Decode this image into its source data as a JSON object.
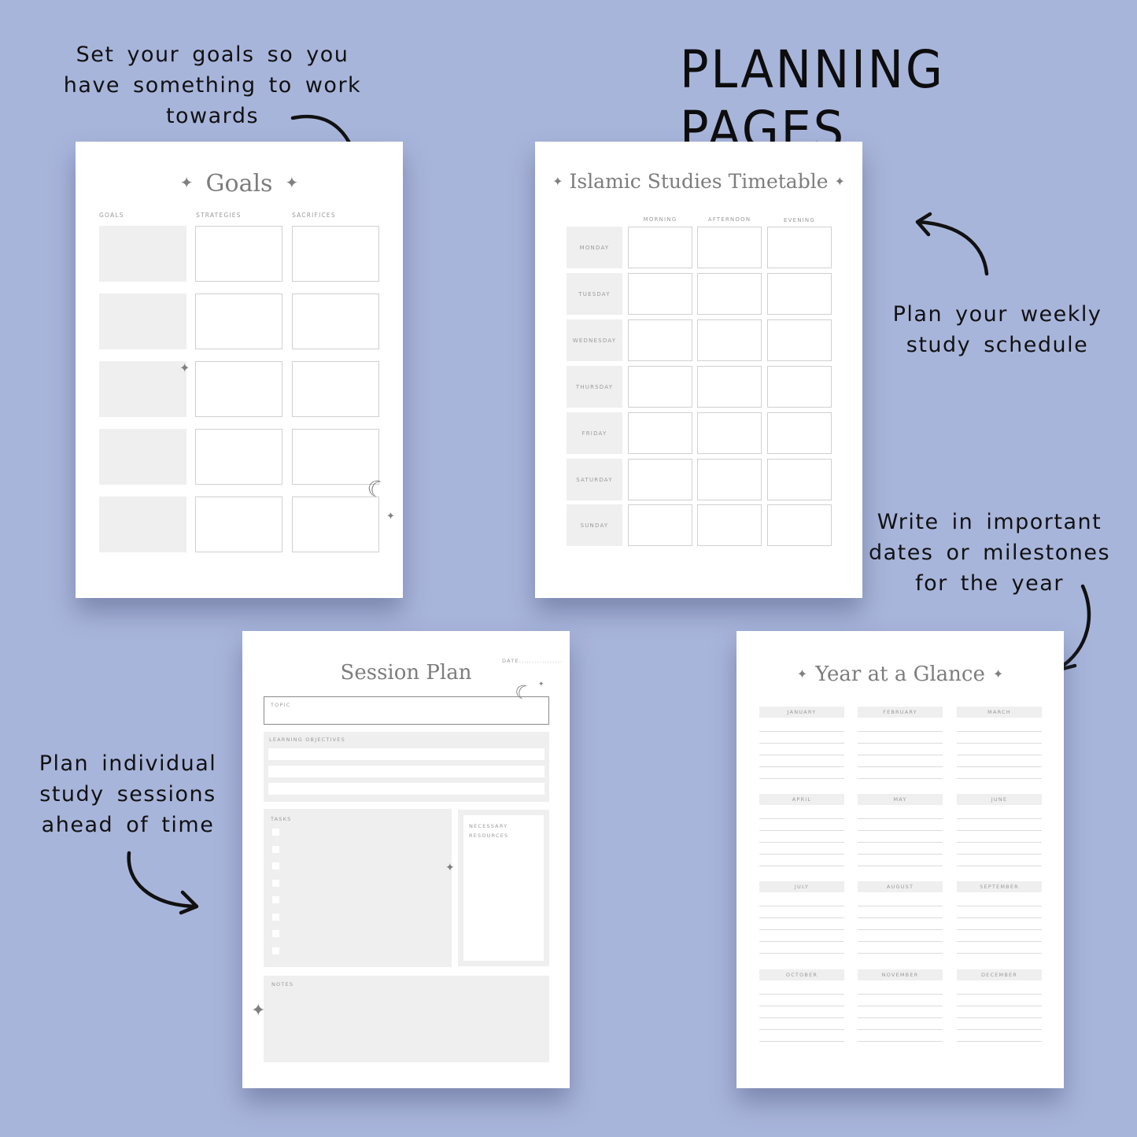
{
  "headline": "PLANNING PAGES",
  "colors": {
    "background": "#a8b5db",
    "page": "#ffffff",
    "fill": "#efefef",
    "title_gray": "#7d7d7d",
    "ink": "#111111"
  },
  "callouts": {
    "goals": [
      "Set your goals so you",
      "have something to work",
      "towards"
    ],
    "weekly": [
      "Plan your weekly",
      "study schedule"
    ],
    "year": [
      "Write in important",
      "dates or milestones",
      "for the year"
    ],
    "session": [
      "Plan individual",
      "study sessions",
      "ahead of time"
    ]
  },
  "goals_page": {
    "title": "Goals",
    "columns": [
      "GOALS",
      "STRATEGIES",
      "SACRIFICES"
    ],
    "row_count": 5,
    "decorations": [
      "sparkle-icon",
      "moon-icon"
    ]
  },
  "timetable_page": {
    "title": "Islamic Studies Timetable",
    "columns": [
      "MORNING",
      "AFTERNOON",
      "EVENING"
    ],
    "days": [
      "MONDAY",
      "TUESDAY",
      "WEDNESDAY",
      "THURSDAY",
      "FRIDAY",
      "SATURDAY",
      "SUNDAY"
    ]
  },
  "session_page": {
    "title": "Session Plan",
    "date_label": "DATE.................",
    "topic_label": "TOPIC",
    "objectives_label": "LEARNING OBJECTIVES",
    "objective_lines": 3,
    "tasks_label": "TASKS",
    "task_checkboxes": 8,
    "resources_label": [
      "NECESSARY",
      "RESOURCES"
    ],
    "notes_label": "NOTES"
  },
  "year_page": {
    "title": "Year at a Glance",
    "months": [
      "JANUARY",
      "FEBRUARY",
      "MARCH",
      "APRIL",
      "MAY",
      "JUNE",
      "JULY",
      "AUGUST",
      "SEPTEMBER",
      "OCTOBER",
      "NOVEMBER",
      "DECEMBER"
    ],
    "lines_per_month": 5
  },
  "icons": {
    "sparkle": "✦",
    "moon": "☾"
  }
}
